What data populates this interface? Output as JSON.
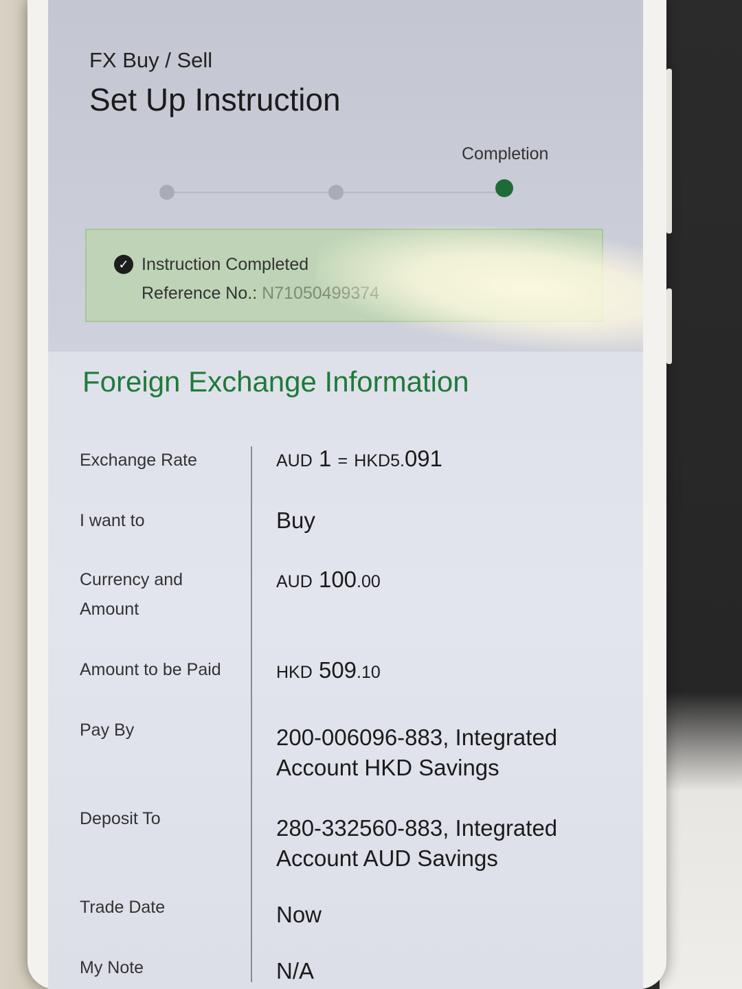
{
  "header": {
    "subtitle": "FX Buy / Sell",
    "title": "Set Up Instruction",
    "current_step_label": "Completion"
  },
  "banner": {
    "status": "Instruction Completed",
    "reference_label": "Reference No.: ",
    "reference_value": "N71050499374"
  },
  "section": {
    "title": "Foreign Exchange Information"
  },
  "details": {
    "exchange_rate": {
      "label": "Exchange Rate",
      "from_currency": "AUD",
      "from_amount": "1",
      "equals": "=",
      "to_currency": "HKD",
      "to_int": "5.",
      "to_dec": "091"
    },
    "want_to": {
      "label": "I want to",
      "value": "Buy"
    },
    "currency_amount": {
      "label": "Currency and Amount",
      "currency": "AUD",
      "int": "100",
      "dec": ".00"
    },
    "amount_paid": {
      "label": "Amount to be Paid",
      "currency": "HKD",
      "int": "509",
      "dec": ".10"
    },
    "pay_by": {
      "label": "Pay By",
      "value": "200-006096-883, Integrated Account HKD Savings"
    },
    "deposit_to": {
      "label": "Deposit To",
      "value": "280-332560-883, Integrated Account AUD Savings"
    },
    "trade_date": {
      "label": "Trade Date",
      "value": "Now"
    },
    "my_note": {
      "label": "My Note",
      "value": "N/A"
    }
  },
  "colors": {
    "accent_green": "#1f7a3a",
    "banner_bg": "#bfd4b6",
    "step_active": "#1e6b3a"
  }
}
